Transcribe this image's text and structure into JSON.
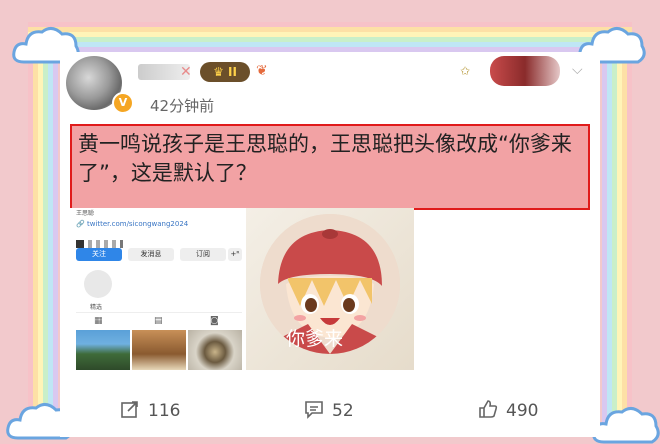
{
  "post": {
    "time": "42分钟前",
    "level_badge": "II",
    "verified_badge": "V",
    "text": "黄一鸣说孩子是王思聪的，王思聪把头像改成“你爹来了”，这是默认了？"
  },
  "screenshot_profile": {
    "name": "王思聪",
    "link": "twitter.com/sicongwang2024",
    "buttons": {
      "follow": "关注",
      "message": "发消息",
      "subscribe": "订阅",
      "more": "+ᴿ"
    },
    "choice_label": "精选",
    "tabs": {
      "grid": "▦",
      "video": "▤",
      "tagged": "◙"
    }
  },
  "screenshot_avatar": {
    "caption": "你爹来"
  },
  "actions": {
    "repost_count": "116",
    "comment_count": "52",
    "like_count": "490"
  },
  "colors": {
    "highlight_bg": "#f2a2a4",
    "highlight_border": "#e01b1b",
    "page_bg": "#f2c9cc"
  }
}
